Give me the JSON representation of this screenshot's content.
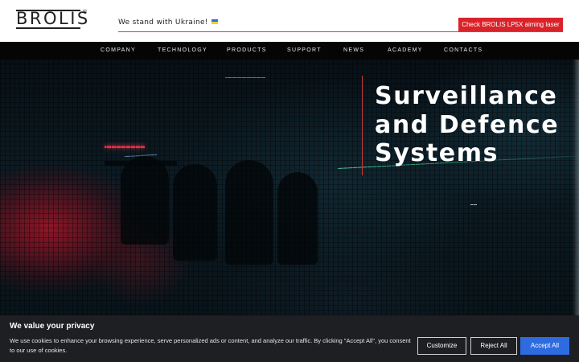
{
  "header": {
    "logo_text": "BROLIS",
    "logo_mark": "®",
    "ukraine_text": "We stand with Ukraine!",
    "flag_icon": "ukraine-flag-icon",
    "cta_label": "Check BROLIS LP5X aiming laser",
    "colors": {
      "cta": "#d9222a",
      "rule": "#d24040"
    }
  },
  "nav": {
    "items": [
      {
        "label": "COMPANY"
      },
      {
        "label": "TECHNOLOGY"
      },
      {
        "label": "PRODUCTS"
      },
      {
        "label": "SUPPORT"
      },
      {
        "label": "NEWS"
      },
      {
        "label": "ACADEMY"
      },
      {
        "label": "CONTACTS"
      }
    ]
  },
  "hero": {
    "title_line1": "Surveillance",
    "title_line2": "and Defence",
    "title_line3": "Systems",
    "colors": {
      "accent_red": "#e4344a",
      "laser_green": "#4fdba0"
    }
  },
  "cookie": {
    "heading": "We value your privacy",
    "text": "We use cookies to enhance your browsing experience, serve personalized ads or content, and analyze our traffic. By clicking \"Accept All\", you consent to our use of cookies.",
    "customize_label": "Customize",
    "reject_label": "Reject All",
    "accept_label": "Accept All",
    "colors": {
      "background": "#1e1f22",
      "accept": "#2f6be0"
    }
  }
}
